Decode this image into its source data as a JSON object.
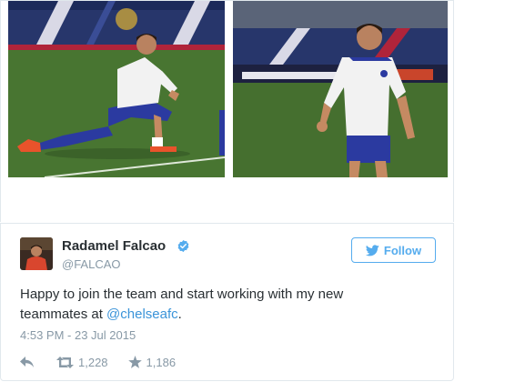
{
  "tweet": {
    "display_name": "Radamel Falcao",
    "handle": "@FALCAO",
    "follow_label": "Follow",
    "text_prefix": "Happy to join the team and start working with my new teammates at ",
    "mention": "@chelseafc",
    "text_suffix": ".",
    "timestamp": "4:53 PM - 23 Jul 2015",
    "retweet_count": "1,228",
    "favorite_count": "1,186"
  },
  "colors": {
    "twitter_blue": "#55acee",
    "link_blue": "#3b94d9",
    "text_dark": "#292f33",
    "text_muted": "#8899a6",
    "border": "#e1e8ed"
  },
  "icons": {
    "verified": "verified-badge-icon",
    "follow": "twitter-bird-icon",
    "reply": "reply-icon",
    "retweet": "retweet-icon",
    "favorite": "star-icon"
  }
}
